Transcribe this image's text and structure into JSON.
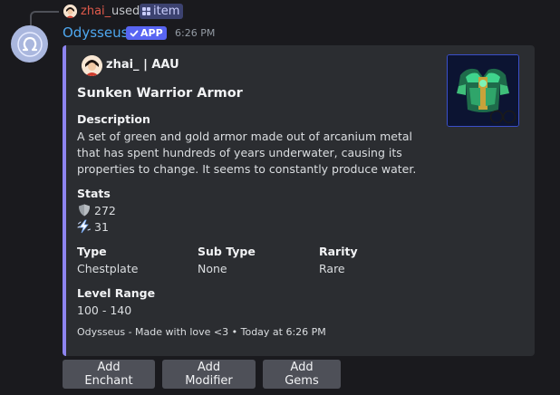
{
  "command": {
    "user": "zhai_",
    "used_text": "used",
    "command_name": "item"
  },
  "message": {
    "bot_name": "Odysseus",
    "badge": "APP",
    "time": "6:26 PM"
  },
  "embed": {
    "accent_color": "#8d84ef",
    "author": "zhai_ | AAU",
    "title": "Sunken Warrior Armor",
    "description_label": "Description",
    "description": "A set of green and gold armor made out of arcanium metal that has spent hundreds of years underwater, causing its properties to change. It seems to constantly produce water.",
    "stats_label": "Stats",
    "stats": [
      {
        "icon": "shield-icon",
        "value": "272"
      },
      {
        "icon": "lightning-icon",
        "value": "31"
      }
    ],
    "fields": [
      {
        "name": "Type",
        "value": "Chestplate"
      },
      {
        "name": "Sub Type",
        "value": "None"
      },
      {
        "name": "Rarity",
        "value": "Rare"
      }
    ],
    "level_label": "Level Range",
    "level_value": "100 - 140",
    "footer": "Odysseus - Made with love <3 • Today at 6:26 PM"
  },
  "buttons": {
    "enchant": "Add Enchant",
    "modifier": "Add Modifier",
    "gems": "Add Gems"
  }
}
